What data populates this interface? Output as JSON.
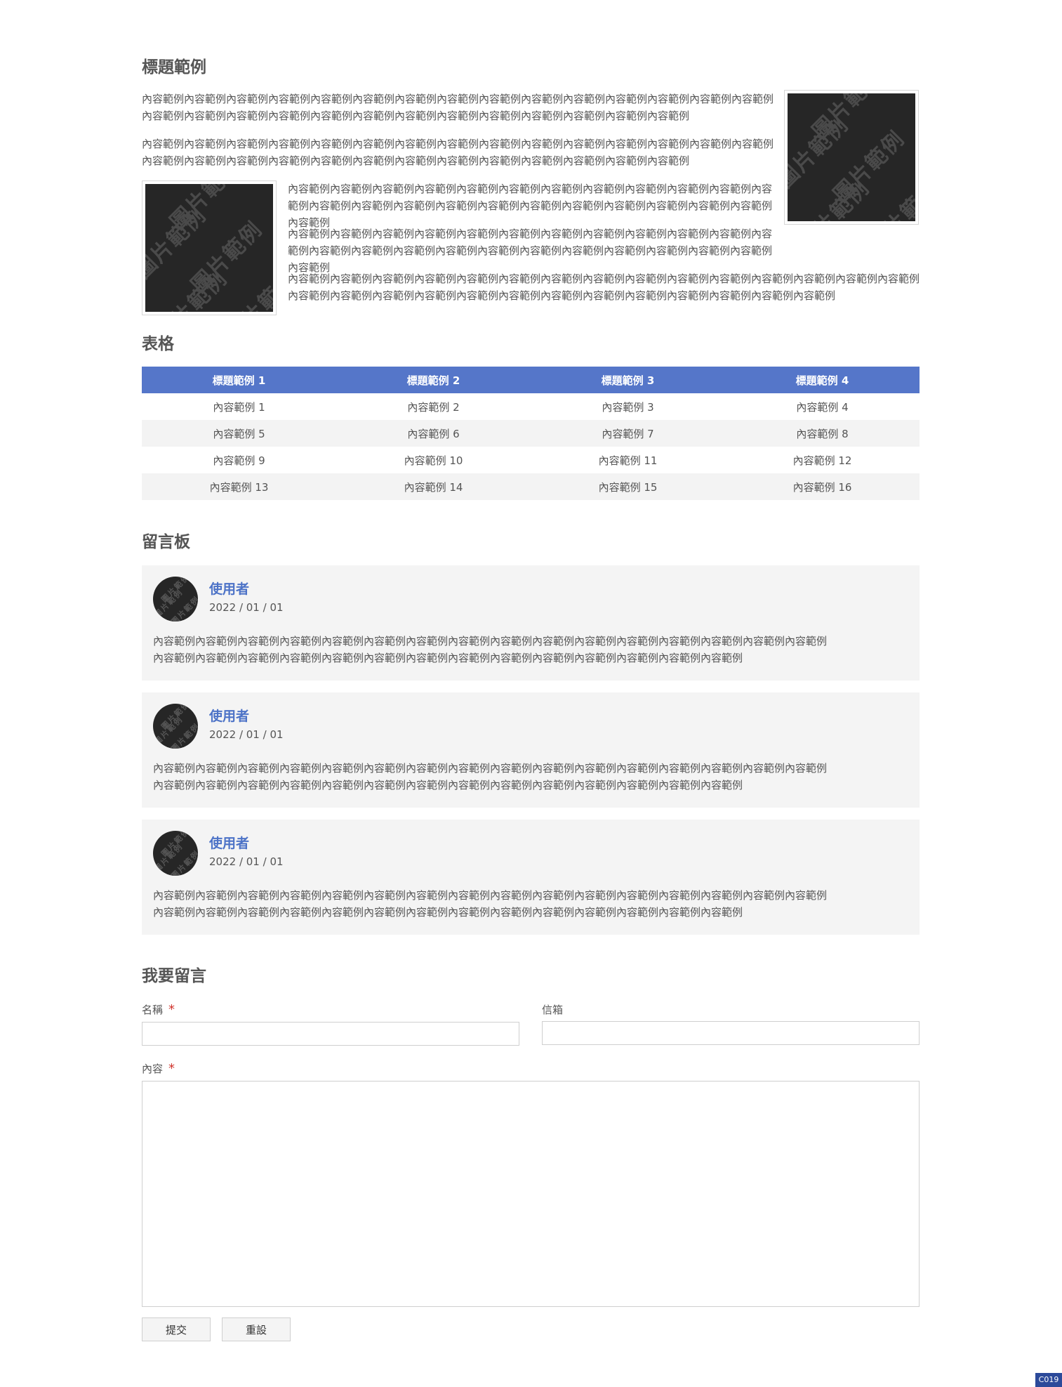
{
  "article": {
    "title": "標題範例",
    "paragraphs": [
      "內容範例內容範例內容範例內容範例內容範例內容範例內容範例內容範例內容範例內容範例內容範例內容範例內容範例內容範例內容範例內容範例內容範例內容範例內容範例內容範例內容範例內容範例內容範例內容範例內容範例內容範例內容範例內容範例",
      "內容範例內容範例內容範例內容範例內容範例內容範例內容範例內容範例內容範例內容範例內容範例內容範例內容範例內容範例內容範例內容範例內容範例內容範例內容範例內容範例內容範例內容範例內容範例內容範例內容範例內容範例內容範例內容範例",
      "內容範例內容範例內容範例內容範例內容範例內容範例內容範例內容範例內容範例內容範例內容範例內容範例內容範例內容範例內容範例內容範例內容範例內容範例內容範例內容範例內容範例內容範例內容範例內容範例",
      "內容範例內容範例內容範例內容範例內容範例內容範例內容範例內容範例內容範例內容範例內容範例內容範例內容範例內容範例內容範例內容範例內容範例內容範例內容範例內容範例內容範例內容範例內容範例內容範例",
      "內容範例內容範例內容範例內容範例內容範例內容範例內容範例內容範例內容範例內容範例內容範例內容範例內容範例內容範例內容範例內容範例內容範例內容範例內容範例內容範例內容範例內容範例內容範例內容範例內容範例內容範例內容範例內容範例"
    ],
    "image_watermark": "圖片範例"
  },
  "table": {
    "title": "表格",
    "headers": [
      "標題範例 1",
      "標題範例 2",
      "標題範例 3",
      "標題範例 4"
    ],
    "rows": [
      [
        "內容範例 1",
        "內容範例 2",
        "內容範例 3",
        "內容範例 4"
      ],
      [
        "內容範例 5",
        "內容範例 6",
        "內容範例 7",
        "內容範例 8"
      ],
      [
        "內容範例 9",
        "內容範例 10",
        "內容範例 11",
        "內容範例 12"
      ],
      [
        "內容範例 13",
        "內容範例 14",
        "內容範例 15",
        "內容範例 16"
      ]
    ]
  },
  "board": {
    "title": "留言板",
    "comments": [
      {
        "user": "使用者",
        "date": "2022 / 01 / 01",
        "text": "內容範例內容範例內容範例內容範例內容範例內容範例內容範例內容範例內容範例內容範例內容範例內容範例內容範例內容範例內容範例內容範例內容範例內容範例內容範例內容範例內容範例內容範例內容範例內容範例內容範例內容範例內容範例內容範例內容範例內容範例"
      },
      {
        "user": "使用者",
        "date": "2022 / 01 / 01",
        "text": "內容範例內容範例內容範例內容範例內容範例內容範例內容範例內容範例內容範例內容範例內容範例內容範例內容範例內容範例內容範例內容範例內容範例內容範例內容範例內容範例內容範例內容範例內容範例內容範例內容範例內容範例內容範例內容範例內容範例內容範例"
      },
      {
        "user": "使用者",
        "date": "2022 / 01 / 01",
        "text": "內容範例內容範例內容範例內容範例內容範例內容範例內容範例內容範例內容範例內容範例內容範例內容範例內容範例內容範例內容範例內容範例內容範例內容範例內容範例內容範例內容範例內容範例內容範例內容範例內容範例內容範例內容範例內容範例內容範例內容範例"
      }
    ]
  },
  "form": {
    "title": "我要留言",
    "name_label": "名稱",
    "email_label": "信箱",
    "content_label": "內容",
    "required_mark": "*",
    "name_value": "",
    "email_value": "",
    "content_value": "",
    "submit_label": "提交",
    "reset_label": "重設"
  },
  "badge": "C019",
  "colors": {
    "accent": "#5576c9",
    "username": "#4d73c7",
    "required": "#d0342c"
  }
}
